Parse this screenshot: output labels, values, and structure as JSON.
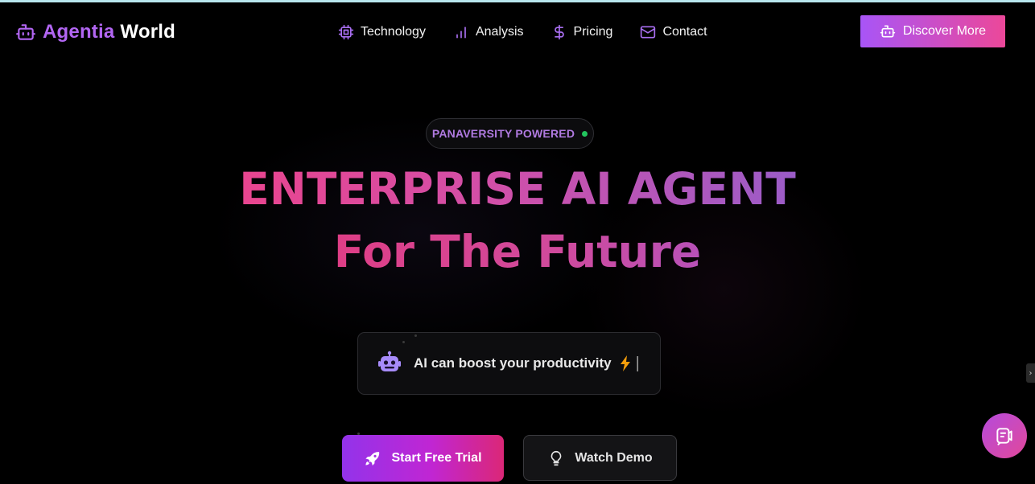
{
  "brand": {
    "name_part1": "Agentia",
    "name_part2": "World",
    "icon": "robot-icon"
  },
  "nav": {
    "items": [
      {
        "label": "Technology",
        "icon": "chip-icon"
      },
      {
        "label": "Analysis",
        "icon": "bar-chart-icon"
      },
      {
        "label": "Pricing",
        "icon": "dollar-icon"
      },
      {
        "label": "Contact",
        "icon": "mail-icon"
      }
    ],
    "cta_label": "Discover More",
    "cta_icon": "robot-icon"
  },
  "hero": {
    "badge_text": "PANAVERSITY POWERED",
    "headline_line1": "ENTERPRISE AI AGENT",
    "headline_line2": "For The Future",
    "typing_text": "AI can boost your productivity",
    "typing_icon": "robot-icon",
    "typing_emoji_icon": "lightning-icon",
    "typing_cursor": "|"
  },
  "cta": {
    "primary_label": "Start Free Trial",
    "primary_icon": "rocket-icon",
    "secondary_label": "Watch Demo",
    "secondary_icon": "lightbulb-icon"
  },
  "widgets": {
    "edge_tab_glyph": "›",
    "chat_icon": "chat-bot-icon"
  },
  "colors": {
    "background": "#000000",
    "accent_purple": "#a855f7",
    "accent_pink": "#ec4899",
    "badge_text": "#b07ae0",
    "status_dot": "#22c55e",
    "top_border": "#b8e6ee"
  }
}
